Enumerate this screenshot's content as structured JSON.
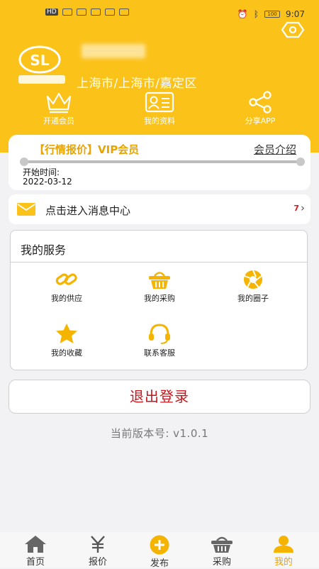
{
  "status_bar": {
    "left_badges": [
      "HD",
      "HD"
    ],
    "time": "9:07",
    "battery": "100"
  },
  "colors": {
    "brand": "#fbc21a",
    "accent": "#e8a400",
    "logout": "#c8151b",
    "background": "#f2f2f4"
  },
  "profile": {
    "logo_icon": "company-logo",
    "location": "上海市/上海市/嘉定区"
  },
  "quick_actions": [
    {
      "label": "开通会员",
      "icon": "crown-icon"
    },
    {
      "label": "我的资料",
      "icon": "profile-card-icon"
    },
    {
      "label": "分享APP",
      "icon": "share-icon"
    }
  ],
  "vip": {
    "title": "【行情报价】VIP会员",
    "intro_link": "会员介绍",
    "start_label": "开始时间:",
    "start_date": "2022-03-12",
    "progress": 1.0
  },
  "message_center": {
    "label": "点击进入消息中心",
    "count": "7",
    "icon": "mail-icon"
  },
  "services": {
    "title": "我的服务",
    "items": [
      {
        "label": "我的供应",
        "icon": "link-icon"
      },
      {
        "label": "我的采购",
        "icon": "basket-icon"
      },
      {
        "label": "我的圈子",
        "icon": "aperture-icon"
      },
      {
        "label": "我的收藏",
        "icon": "star-icon"
      },
      {
        "label": "联系客服",
        "icon": "headset-icon"
      }
    ]
  },
  "logout_label": "退出登录",
  "version_text": "当前版本号: v1.0.1",
  "tabbar": {
    "active": "我的",
    "items": [
      {
        "label": "首页",
        "icon": "home-icon"
      },
      {
        "label": "报价",
        "icon": "yen-icon"
      },
      {
        "label": "发布",
        "icon": "plus-circle-icon"
      },
      {
        "label": "采购",
        "icon": "basket-icon"
      },
      {
        "label": "我的",
        "icon": "user-icon"
      }
    ]
  }
}
